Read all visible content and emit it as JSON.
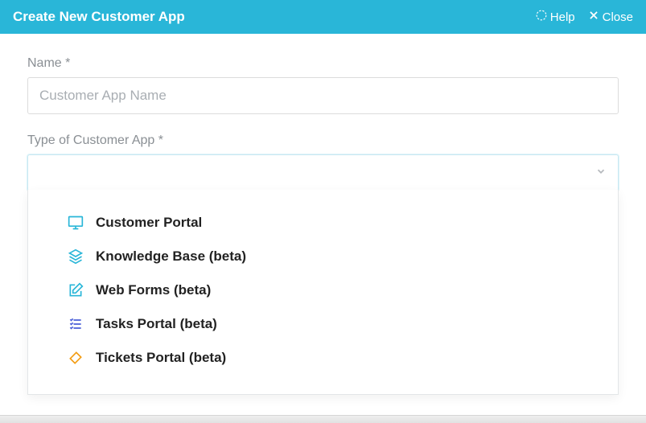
{
  "header": {
    "title": "Create New Customer App",
    "help_label": "Help",
    "close_label": "Close"
  },
  "form": {
    "name_label": "Name *",
    "name_placeholder": "Customer App Name",
    "type_label": "Type of Customer App *"
  },
  "dropdown": {
    "options": [
      {
        "icon": "monitor-icon",
        "color": "c-blue",
        "label": "Customer Portal"
      },
      {
        "icon": "layers-icon",
        "color": "c-blue",
        "label": "Knowledge Base (beta)"
      },
      {
        "icon": "edit-square-icon",
        "color": "c-blue",
        "label": "Web Forms (beta)"
      },
      {
        "icon": "checklist-icon",
        "color": "c-indigo",
        "label": "Tasks Portal (beta)"
      },
      {
        "icon": "ticket-icon",
        "color": "c-orange",
        "label": "Tickets Portal (beta)"
      }
    ]
  }
}
